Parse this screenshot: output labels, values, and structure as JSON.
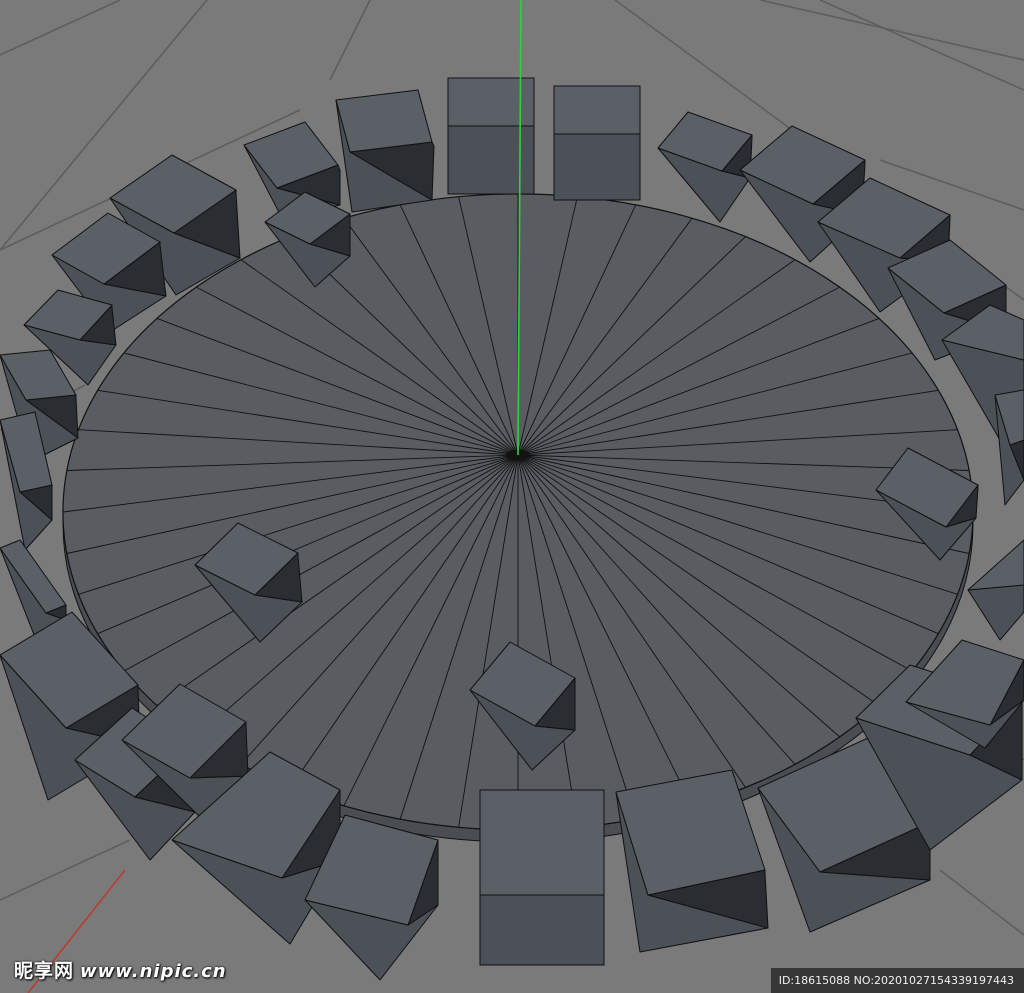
{
  "viewport": {
    "background_color": "#7a7a7a",
    "grid_color": "#5e5e5e",
    "disc_color": "#595d62",
    "disc_edge_color": "#4a4e52",
    "wire_color": "#111111",
    "cube_top_color": "#5b6067",
    "cube_left_color": "#4c5157",
    "cube_right_color": "#2a2d31",
    "y_axis_color": "#2fd13b",
    "x_axis_color": "#c0392b",
    "disc_segments": 48
  },
  "watermark": {
    "brand": "昵享网",
    "url": "www.nipic.cn",
    "id_text": "ID:18615088 NO:20201027154339197443"
  }
}
